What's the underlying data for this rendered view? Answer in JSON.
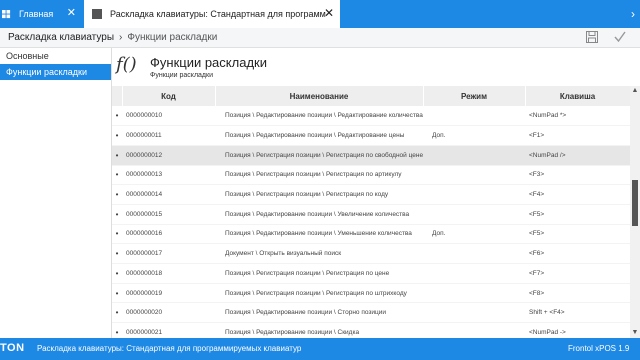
{
  "tabs": {
    "home": {
      "label": "Главная",
      "close": "✕"
    },
    "active": {
      "label": "Раскладка клавиатуры: Стандартная для программируемых клавиатур",
      "close": "✕"
    },
    "more": "›"
  },
  "breadcrumb": {
    "root": "Раскладка клавиатуры",
    "separator": "›",
    "current": "Функции раскладки"
  },
  "sidebar": {
    "items": [
      {
        "label": "Основные",
        "active": false
      },
      {
        "label": "Функции раскладки",
        "active": true
      }
    ]
  },
  "page": {
    "icon_glyph": "f()",
    "title": "Функции раскладки",
    "subtitle": "Функции раскладки"
  },
  "table": {
    "headers": {
      "code": "Код",
      "name": "Наименование",
      "mode": "Режим",
      "key": "Клавиша"
    },
    "bullet": "•",
    "rows": [
      {
        "code": "0000000010",
        "name": "Позиция \\ Редактирование позиции \\ Редактирование количества",
        "mode": "",
        "key": "<NumPad *>"
      },
      {
        "code": "0000000011",
        "name": "Позиция \\ Редактирование позиции \\ Редактирование цены",
        "mode": "Доп.",
        "key": "<F1>"
      },
      {
        "code": "0000000012",
        "name": "Позиция \\ Регистрация позиции \\ Регистрация по свободной цене",
        "mode": "",
        "key": "<NumPad />"
      },
      {
        "code": "0000000013",
        "name": "Позиция \\ Регистрация позиции \\ Регистрация по артикулу",
        "mode": "",
        "key": "<F3>"
      },
      {
        "code": "0000000014",
        "name": "Позиция \\ Регистрация позиции \\ Регистрация по коду",
        "mode": "",
        "key": "<F4>"
      },
      {
        "code": "0000000015",
        "name": "Позиция \\ Редактирование позиции \\ Увеличение количества",
        "mode": "",
        "key": "<F5>"
      },
      {
        "code": "0000000016",
        "name": "Позиция \\ Редактирование позиции \\ Уменьшение количества",
        "mode": "Доп.",
        "key": "<F5>"
      },
      {
        "code": "0000000017",
        "name": "Документ \\ Открыть визуальный поиск",
        "mode": "",
        "key": "<F6>"
      },
      {
        "code": "0000000018",
        "name": "Позиция \\ Регистрация позиции \\ Регистрация по цене",
        "mode": "",
        "key": "<F7>"
      },
      {
        "code": "0000000019",
        "name": "Позиция \\ Регистрация позиции \\ Регистрация по штрихкоду",
        "mode": "",
        "key": "<F8>"
      },
      {
        "code": "0000000020",
        "name": "Позиция \\ Редактирование позиции \\ Сторно позиции",
        "mode": "",
        "key": "Shift + <F4>"
      },
      {
        "code": "0000000021",
        "name": "Позиция \\ Редактирование позиции \\ Скидка",
        "mode": "",
        "key": "<NumPad ->"
      }
    ],
    "selected_index": 2
  },
  "status": {
    "brand": "TON",
    "text": "Раскладка клавиатуры: Стандартная для программируемых клавиатур",
    "version": "Frontol xPOS 1.9"
  },
  "colors": {
    "accent": "#1e88e5",
    "selected_row": "#e6e6e6",
    "header_bg": "#eeeeee"
  }
}
